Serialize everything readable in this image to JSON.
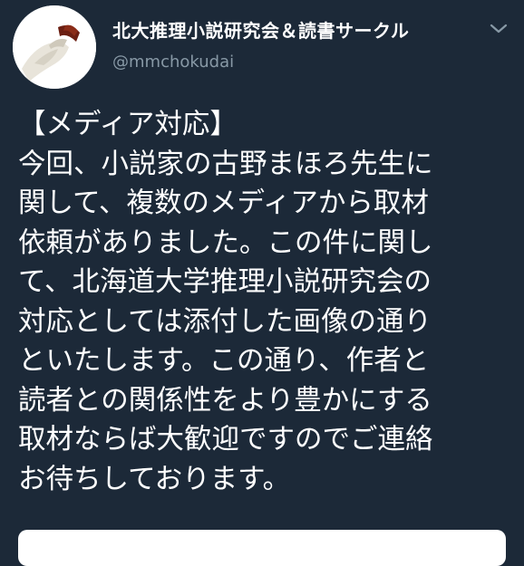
{
  "profile": {
    "display_name": "北大推理小説研究会＆読書サークル",
    "handle": "@mmchokudai"
  },
  "tweet": {
    "lines": [
      "【メディア対応】",
      "今回、小説家の古野まほろ先生に",
      "関して、複数のメディアから取材",
      "依頼がありました。この件に関し",
      "て、北海道大学推理小説研究会の",
      "対応としては添付した画像の通り",
      "といたします。この通り、作者と",
      "読者との関係性をより豊かにする",
      "取材ならば大歓迎ですのでご連絡",
      "お待ちしております。"
    ]
  },
  "icons": {
    "avatar": "pipe-avatar-icon",
    "menu": "chevron-down-icon"
  },
  "colors": {
    "background": "#1c2938",
    "handle": "#8899a6",
    "text": "#ffffff"
  }
}
